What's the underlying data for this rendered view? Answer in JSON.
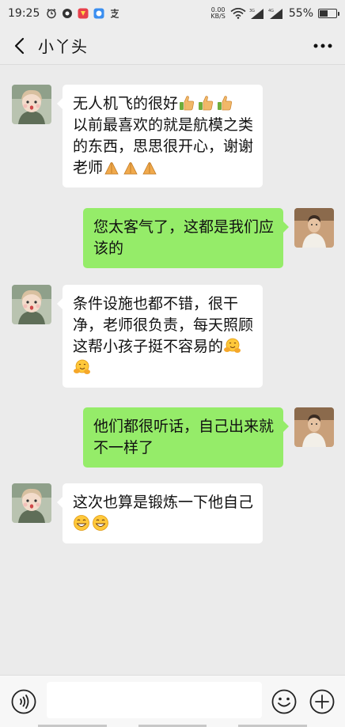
{
  "status_bar": {
    "time": "19:25",
    "net_speed_value": "0.00",
    "net_speed_unit": "KB/S",
    "signal_1_label": "3G",
    "signal_2_label": "4G",
    "battery_percent": "55%",
    "battery_level": 0.55,
    "icons": [
      "alarm-icon",
      "notification-dot-icon",
      "app-badge-icon",
      "browser-icon",
      "pay-icon",
      "wifi-icon",
      "signal-icon",
      "battery-icon"
    ]
  },
  "header": {
    "title": "小丫头",
    "back_icon": "back-arrow-icon",
    "more_icon": "more-dots-icon"
  },
  "messages": [
    {
      "direction": "in",
      "lines": [
        "无人机飞的很好",
        "以前最喜欢的就是航模之类",
        "的东西，思思很开心，谢谢",
        "老师"
      ],
      "emoji_after": {
        "0": [
          "thumbs-up",
          "thumbs-up",
          "thumbs-up"
        ],
        "3": [
          "praying-hands",
          "praying-hands",
          "praying-hands"
        ]
      }
    },
    {
      "direction": "out",
      "lines": [
        "您太客气了，这都是我们应",
        "该的"
      ]
    },
    {
      "direction": "in",
      "lines": [
        "条件设施也都不错，很干",
        "净，老师很负责，每天照顾",
        "这帮小孩子挺不容易的",
        ""
      ],
      "emoji_after": {
        "2": [
          "hugging-face"
        ],
        "3": [
          "hugging-face"
        ]
      }
    },
    {
      "direction": "out",
      "lines": [
        "他们都很听话，自己出来就",
        "不一样了"
      ]
    },
    {
      "direction": "in",
      "lines": [
        "这次也算是锻炼一下他自己",
        ""
      ],
      "emoji_after": {
        "1": [
          "grinning-face",
          "grinning-face"
        ]
      }
    }
  ],
  "input_bar": {
    "text_value": "",
    "voice_icon": "voice-icon",
    "emoji_icon": "emoji-icon",
    "plus_icon": "plus-icon"
  },
  "colors": {
    "background": "#ebebeb",
    "bubble_in": "#ffffff",
    "bubble_out": "#95ec69",
    "header": "#ededed"
  }
}
